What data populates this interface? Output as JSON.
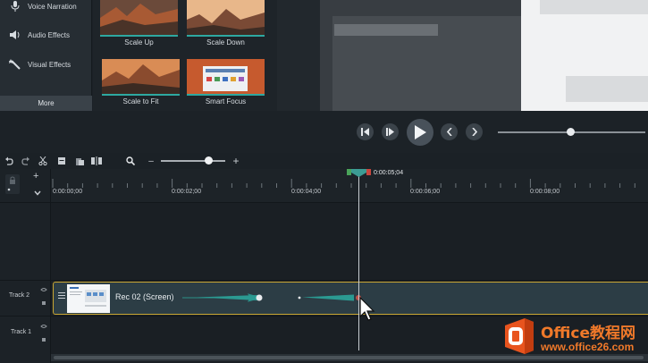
{
  "sidebar": {
    "items": [
      {
        "label": "Voice Narration",
        "icon": "microphone-icon"
      },
      {
        "label": "Audio Effects",
        "icon": "speaker-icon"
      },
      {
        "label": "Visual Effects",
        "icon": "magic-wand-icon"
      }
    ],
    "more_label": "More"
  },
  "media_bin": {
    "thumbnails": [
      {
        "label": "Scale Up"
      },
      {
        "label": "Scale Down"
      },
      {
        "label": "Scale to Fit"
      },
      {
        "label": "Smart Focus"
      }
    ]
  },
  "playback": {
    "buttons": [
      "step-back-icon",
      "step-forward-icon",
      "play-icon",
      "previous-icon",
      "next-icon"
    ],
    "volume_level": 0.47
  },
  "timeline_toolbar": {
    "zoom_in_label": "+",
    "zoom_out_label": "–",
    "zoom_level": 0.68
  },
  "ruler": {
    "playhead_time": "0:00:05;04",
    "ticks": [
      "0:00:00;00",
      "0:00:02;00",
      "0:00:04;00",
      "0:00:06;00",
      "0:00:08;00"
    ]
  },
  "tracks": [
    {
      "label": "Track 2",
      "clip_title": "Rec 02 (Screen)"
    },
    {
      "label": "Track 1"
    }
  ],
  "track_controls": {
    "add_label": "+"
  },
  "watermark": {
    "title": "Office教程网",
    "url": "www.office26.com"
  },
  "colors": {
    "accent_teal": "#2ea8a0",
    "clip_border": "#c9a632",
    "watermark_orange": "#f0792a"
  }
}
